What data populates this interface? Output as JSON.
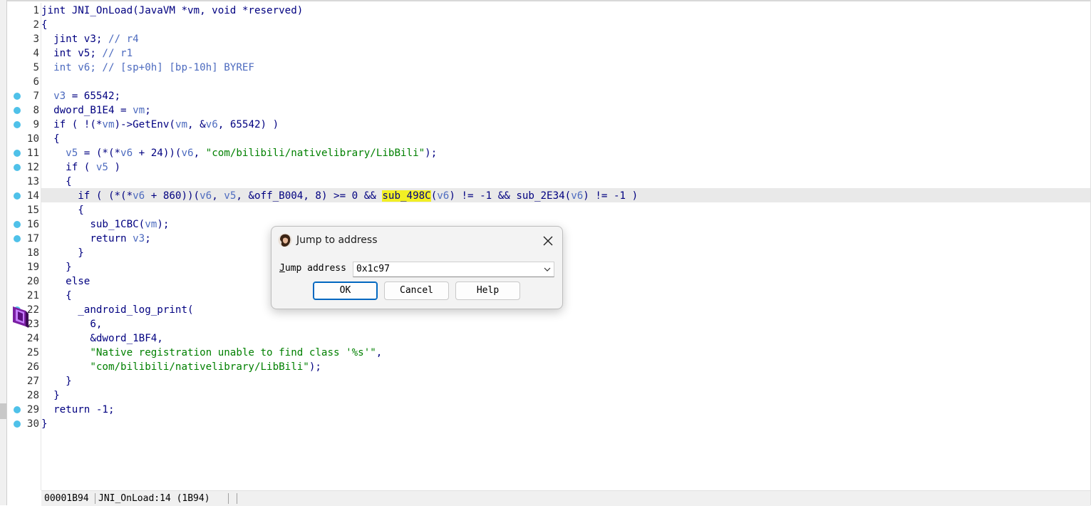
{
  "editor": {
    "lines": [
      {
        "n": "1",
        "bp": false,
        "segs": [
          [
            "kw",
            "jint JNI_OnLoad(JavaVM *vm, void *reserved)"
          ]
        ]
      },
      {
        "n": "2",
        "bp": false,
        "segs": [
          [
            "kw",
            "{"
          ]
        ]
      },
      {
        "n": "3",
        "bp": false,
        "segs": [
          [
            "kw",
            "  jint v3; "
          ],
          [
            "cm",
            "// r4"
          ]
        ]
      },
      {
        "n": "4",
        "bp": false,
        "segs": [
          [
            "kw",
            "  int v5; "
          ],
          [
            "cm",
            "// r1"
          ]
        ]
      },
      {
        "n": "5",
        "bp": false,
        "segs": [
          [
            "cm",
            "  int v6; // [sp+0h] [bp-10h] BYREF"
          ]
        ]
      },
      {
        "n": "6",
        "bp": false,
        "segs": [
          [
            "kw",
            ""
          ]
        ]
      },
      {
        "n": "7",
        "bp": true,
        "segs": [
          [
            "var",
            "  v3"
          ],
          [
            "kw",
            " = 65542;"
          ]
        ]
      },
      {
        "n": "8",
        "bp": true,
        "segs": [
          [
            "kw",
            "  dword_B1E4 = "
          ],
          [
            "var",
            "vm"
          ],
          [
            "kw",
            ";"
          ]
        ]
      },
      {
        "n": "9",
        "bp": true,
        "segs": [
          [
            "kw",
            "  if ( !(*"
          ],
          [
            "var",
            "vm"
          ],
          [
            "kw",
            ")->GetEnv("
          ],
          [
            "var",
            "vm"
          ],
          [
            "kw",
            ", &"
          ],
          [
            "var",
            "v6"
          ],
          [
            "kw",
            ", 65542) )"
          ]
        ]
      },
      {
        "n": "10",
        "bp": false,
        "segs": [
          [
            "kw",
            "  {"
          ]
        ]
      },
      {
        "n": "11",
        "bp": true,
        "segs": [
          [
            "var",
            "    v5"
          ],
          [
            "kw",
            " = (*(*"
          ],
          [
            "var",
            "v6"
          ],
          [
            "kw",
            " + 24))("
          ],
          [
            "var",
            "v6"
          ],
          [
            "kw",
            ", "
          ],
          [
            "str",
            "\"com/bilibili/nativelibrary/LibBili\""
          ],
          [
            "kw",
            ");"
          ]
        ]
      },
      {
        "n": "12",
        "bp": true,
        "segs": [
          [
            "kw",
            "    if ( "
          ],
          [
            "var",
            "v5"
          ],
          [
            "kw",
            " )"
          ]
        ]
      },
      {
        "n": "13",
        "bp": false,
        "segs": [
          [
            "kw",
            "    {"
          ]
        ]
      },
      {
        "n": "14",
        "bp": true,
        "segs": [
          [
            "kw",
            "      if ( (*(*"
          ],
          [
            "var",
            "v6"
          ],
          [
            "kw",
            " + 860))("
          ],
          [
            "var",
            "v6"
          ],
          [
            "kw",
            ", "
          ],
          [
            "var",
            "v5"
          ],
          [
            "kw",
            ", &off_B004, 8) >= 0 && "
          ],
          [
            "hl",
            "sub_498C"
          ],
          [
            "kw",
            "("
          ],
          [
            "var",
            "v6"
          ],
          [
            "kw",
            ") != -1 && sub_2E34("
          ],
          [
            "var",
            "v6"
          ],
          [
            "kw",
            ") != -1 )"
          ]
        ]
      },
      {
        "n": "15",
        "bp": false,
        "segs": [
          [
            "kw",
            "      {"
          ]
        ]
      },
      {
        "n": "16",
        "bp": true,
        "segs": [
          [
            "kw",
            "        sub_1CBC("
          ],
          [
            "var",
            "vm"
          ],
          [
            "kw",
            ");"
          ]
        ]
      },
      {
        "n": "17",
        "bp": true,
        "segs": [
          [
            "kw",
            "        return "
          ],
          [
            "var",
            "v3"
          ],
          [
            "kw",
            ";"
          ]
        ]
      },
      {
        "n": "18",
        "bp": false,
        "segs": [
          [
            "kw",
            "      }"
          ]
        ]
      },
      {
        "n": "19",
        "bp": false,
        "segs": [
          [
            "kw",
            "    }"
          ]
        ]
      },
      {
        "n": "20",
        "bp": false,
        "segs": [
          [
            "kw",
            "    else"
          ]
        ]
      },
      {
        "n": "21",
        "bp": false,
        "segs": [
          [
            "kw",
            "    {"
          ]
        ]
      },
      {
        "n": "22",
        "bp": true,
        "segs": [
          [
            "kw",
            "      _android_log_print("
          ]
        ]
      },
      {
        "n": "23",
        "bp": false,
        "segs": [
          [
            "kw",
            "        6,"
          ]
        ]
      },
      {
        "n": "24",
        "bp": false,
        "segs": [
          [
            "kw",
            "        &dword_1BF4,"
          ]
        ]
      },
      {
        "n": "25",
        "bp": false,
        "segs": [
          [
            "str",
            "        \"Native registration unable to find class '%s'\""
          ],
          [
            "kw",
            ","
          ]
        ]
      },
      {
        "n": "26",
        "bp": false,
        "segs": [
          [
            "str",
            "        \"com/bilibili/nativelibrary/LibBili\""
          ],
          [
            "kw",
            ");"
          ]
        ]
      },
      {
        "n": "27",
        "bp": false,
        "segs": [
          [
            "kw",
            "    }"
          ]
        ]
      },
      {
        "n": "28",
        "bp": false,
        "segs": [
          [
            "kw",
            "  }"
          ]
        ]
      },
      {
        "n": "29",
        "bp": true,
        "segs": [
          [
            "kw",
            "  return -1;"
          ]
        ]
      },
      {
        "n": "30",
        "bp": true,
        "segs": [
          [
            "kw",
            "}"
          ]
        ]
      }
    ],
    "current_line": "14",
    "warning_icon": "warning-icon"
  },
  "statusbar": {
    "address": "00001B94",
    "location": "JNI_OnLoad:14 (1B94)"
  },
  "dialog": {
    "title": "Jump to address",
    "app_icon": "ida-icon",
    "label_ul": "J",
    "label_rest": "ump address",
    "value": "0x1c97",
    "ok_label": "OK",
    "cancel_label": "Cancel",
    "help_label": "Help"
  },
  "colors": {
    "breakpoint": "#4fc1e9",
    "highlight": "#f2ef24",
    "string": "#008000",
    "variable": "#4d6bbf",
    "code": "#000080"
  }
}
